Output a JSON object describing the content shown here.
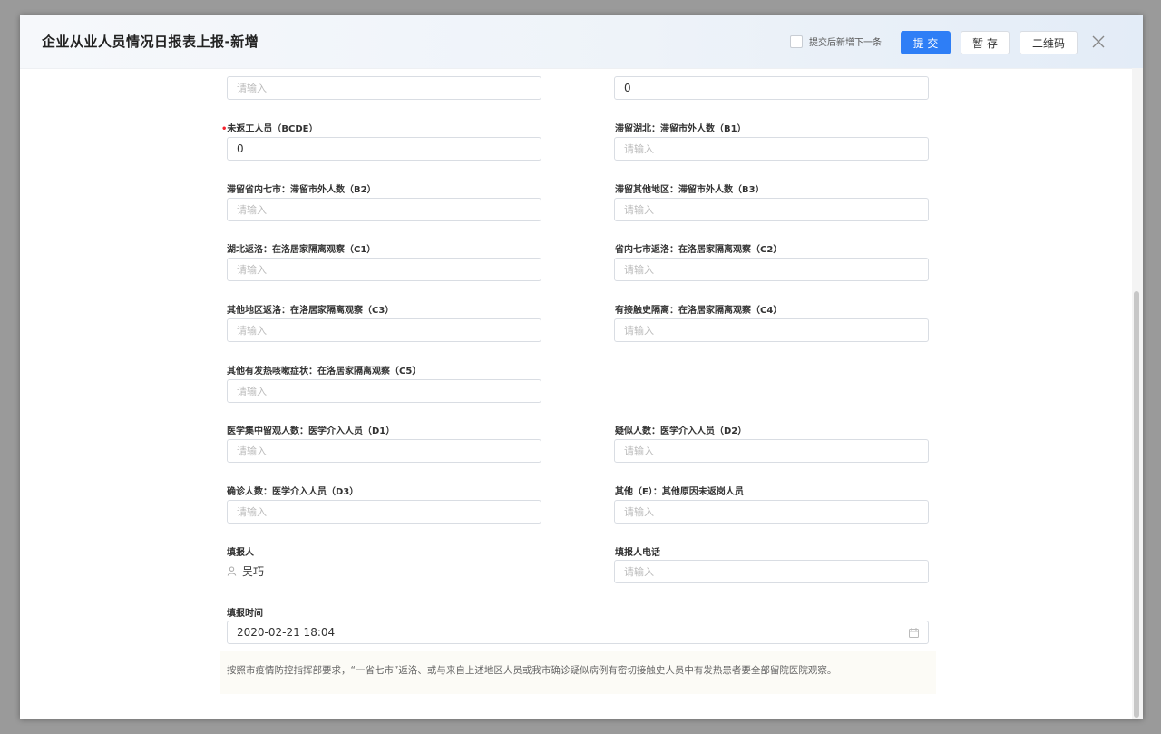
{
  "header": {
    "title": "企业从业人员情况日报表上报-新增",
    "checkbox_label": "提交后新增下一条",
    "submit_label": "提 交",
    "save_label": "暂 存",
    "qr_label": "二维码"
  },
  "fields": {
    "top_left": {
      "value": "",
      "placeholder": "请输入"
    },
    "top_right": {
      "value": "0"
    },
    "bcde": {
      "label": "未返工人员（BCDE）",
      "required_mark": "•",
      "value": "0"
    },
    "b1": {
      "label": "滞留湖北：滞留市外人数（B1）",
      "placeholder": "请输入"
    },
    "b2": {
      "label": "滞留省内七市：滞留市外人数（B2）",
      "placeholder": "请输入"
    },
    "b3": {
      "label": "滞留其他地区：滞留市外人数（B3）",
      "placeholder": "请输入"
    },
    "c1": {
      "label": "湖北返洛：在洛居家隔离观察（C1）",
      "placeholder": "请输入"
    },
    "c2": {
      "label": "省内七市返洛：在洛居家隔离观察（C2）",
      "placeholder": "请输入"
    },
    "c3": {
      "label": "其他地区返洛：在洛居家隔离观察（C3）",
      "placeholder": "请输入"
    },
    "c4": {
      "label": "有接触史隔离：在洛居家隔离观察（C4）",
      "placeholder": "请输入"
    },
    "c5": {
      "label": "其他有发热咳嗽症状：在洛居家隔离观察（C5）",
      "placeholder": "请输入"
    },
    "d1": {
      "label": "医学集中留观人数：医学介入人员（D1）",
      "placeholder": "请输入"
    },
    "d2": {
      "label": "疑似人数：医学介入人员（D2）",
      "placeholder": "请输入"
    },
    "d3": {
      "label": "确诊人数：医学介入人员（D3）",
      "placeholder": "请输入"
    },
    "e": {
      "label": "其他（E）：其他原因未返岗人员",
      "placeholder": "请输入"
    },
    "reporter": {
      "label": "填报人",
      "value": "吴巧"
    },
    "reporter_phone": {
      "label": "填报人电话",
      "placeholder": "请输入"
    },
    "report_time": {
      "label": "填报时间",
      "value": "2020-02-21 18:04"
    }
  },
  "note": "按照市疫情防控指挥部要求，“一省七市”返洛、或与来自上述地区人员或我市确诊疑似病例有密切接触史人员中有发热患者要全部留院医院观察。",
  "icons": {
    "close": "close-icon",
    "calendar": "calendar-icon",
    "person": "person-icon"
  },
  "colors": {
    "primary": "#2e7ef6",
    "required": "#f5222d"
  }
}
